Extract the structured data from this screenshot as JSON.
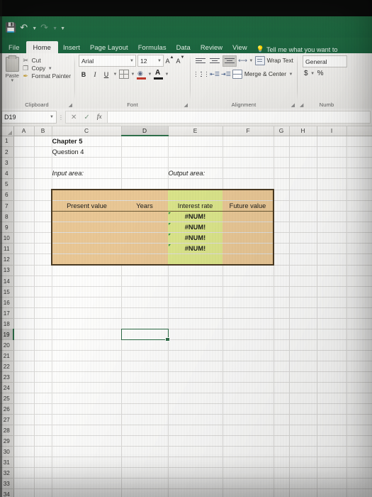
{
  "window": {
    "app": "Microsoft Excel"
  },
  "quick_access": {
    "save_icon": "save-icon",
    "undo_icon": "undo-icon",
    "redo_icon": "redo-icon",
    "customize_icon": "chevron-down-icon"
  },
  "ribbon": {
    "tabs": [
      {
        "label": "File",
        "active": false
      },
      {
        "label": "Home",
        "active": true
      },
      {
        "label": "Insert",
        "active": false
      },
      {
        "label": "Page Layout",
        "active": false
      },
      {
        "label": "Formulas",
        "active": false
      },
      {
        "label": "Data",
        "active": false
      },
      {
        "label": "Review",
        "active": false
      },
      {
        "label": "View",
        "active": false
      }
    ],
    "tell_me": "Tell me what you want to",
    "groups": {
      "clipboard": {
        "label": "Clipboard",
        "paste": "Paste",
        "cut": "Cut",
        "copy": "Copy",
        "format_painter": "Format Painter"
      },
      "font": {
        "label": "Font",
        "font_name": "Arial",
        "font_size": "12",
        "bold": "B",
        "italic": "I",
        "underline": "U"
      },
      "alignment": {
        "label": "Alignment",
        "wrap_text": "Wrap Text",
        "merge_center": "Merge & Center"
      },
      "number": {
        "label": "Numb",
        "format": "General",
        "currency": "$",
        "percent": "%"
      }
    }
  },
  "formula_bar": {
    "name_box": "D19",
    "cancel_icon": "close-icon",
    "enter_icon": "check-icon",
    "function_icon": "fx-icon",
    "value": ""
  },
  "sheet": {
    "columns": [
      "A",
      "B",
      "C",
      "D",
      "E",
      "F",
      "G",
      "H",
      "I"
    ],
    "selected_column": "D",
    "selected_row": "19",
    "selected_cell": "D19",
    "rows": [
      "1",
      "2",
      "3",
      "4",
      "5",
      "6",
      "7",
      "8",
      "9",
      "10",
      "11",
      "12",
      "13",
      "14",
      "15",
      "16",
      "17",
      "18",
      "19",
      "20",
      "21",
      "22",
      "23",
      "24",
      "25",
      "26",
      "27",
      "28",
      "29",
      "30",
      "31",
      "32",
      "33",
      "34"
    ],
    "content": {
      "title": "Chapter 5",
      "question": "Question 4",
      "input_area_label": "Input area:",
      "output_area_label": "Output area:"
    },
    "table": {
      "headers": [
        "Present value",
        "Years",
        "Interest rate",
        "Future value"
      ],
      "rows": [
        {
          "present_value": "",
          "years": "",
          "interest_rate": "#NUM!",
          "future_value": ""
        },
        {
          "present_value": "",
          "years": "",
          "interest_rate": "#NUM!",
          "future_value": ""
        },
        {
          "present_value": "",
          "years": "",
          "interest_rate": "#NUM!",
          "future_value": ""
        },
        {
          "present_value": "",
          "years": "",
          "interest_rate": "#NUM!",
          "future_value": ""
        }
      ]
    },
    "colors": {
      "input_fill": "#e9c795",
      "output_fill": "#dbe58a",
      "error_text": "#1f6b33",
      "border": "#4a3a22",
      "ribbon_accent": "#1d6640"
    }
  }
}
